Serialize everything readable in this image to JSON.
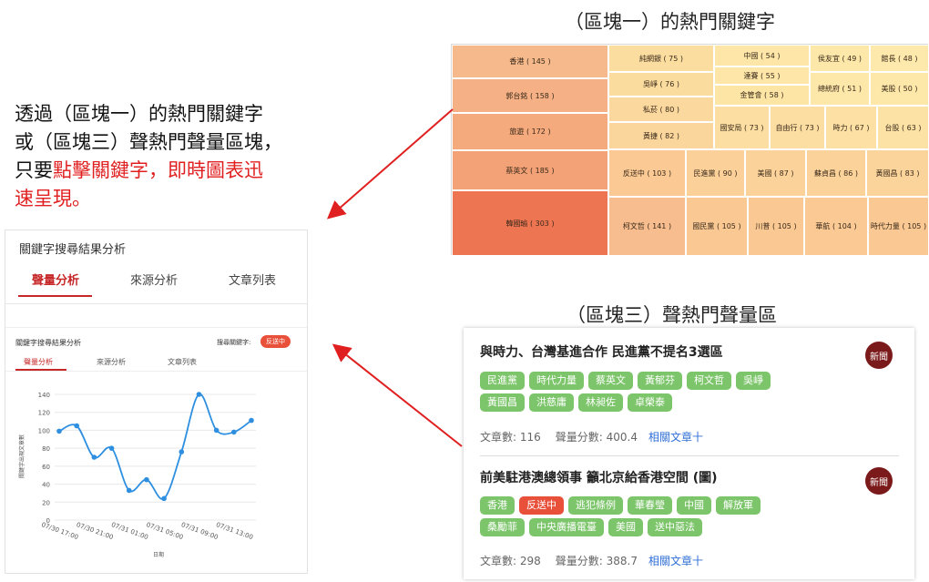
{
  "intro": {
    "line1": "透過（區塊一）的熱門關鍵字",
    "line2": "或（區塊三）聲熱門聲量區塊，",
    "line3_black": "只要",
    "line3_red": "點擊關鍵字，即時圖表迅",
    "line4_red": "速呈現。"
  },
  "block1_title": "（區塊一）的熱門關鍵字",
  "block3_title": "（區塊三）聲熱門聲量區",
  "treemap": {
    "cells": [
      {
        "label": "香港 ( 145 )",
        "color": "#f6b98c"
      },
      {
        "label": "郭台銘 ( 158 )",
        "color": "#f5b185"
      },
      {
        "label": "旅遊 ( 172 )",
        "color": "#f4aa7c"
      },
      {
        "label": "蔡英文 ( 185 )",
        "color": "#f3a176"
      },
      {
        "label": "韓國瑜 ( 303 )",
        "color": "#ee7552"
      },
      {
        "label": "純網銀 ( 75 )",
        "color": "#fbdda0"
      },
      {
        "label": "吳崢 ( 76 )",
        "color": "#fbdc9f"
      },
      {
        "label": "私菸 ( 80 )",
        "color": "#fbd89d"
      },
      {
        "label": "黃捷 ( 82 )",
        "color": "#fbd69c"
      },
      {
        "label": "中國 ( 54 )",
        "color": "#fde6a8"
      },
      {
        "label": "達賽 ( 55 )",
        "color": "#fde6a8"
      },
      {
        "label": "金管會 ( 58 )",
        "color": "#fde5a6"
      },
      {
        "label": "侯友宜 ( 49 )",
        "color": "#fde8aa"
      },
      {
        "label": "總統府 ( 51 )",
        "color": "#fde7a9"
      },
      {
        "label": "館長 ( 48 )",
        "color": "#fde9ab"
      },
      {
        "label": "美股 ( 50 )",
        "color": "#fde8aa"
      },
      {
        "label": "國安局 ( 73 )",
        "color": "#fcdea2"
      },
      {
        "label": "自由行 ( 73 )",
        "color": "#fcdea2"
      },
      {
        "label": "時力 ( 67 )",
        "color": "#fce0a4"
      },
      {
        "label": "台股 ( 63 )",
        "color": "#fce2a5"
      },
      {
        "label": "反送中 ( 103 )",
        "color": "#fac994"
      },
      {
        "label": "民進黨 ( 90 )",
        "color": "#fbd099"
      },
      {
        "label": "美國 ( 87 )",
        "color": "#fbd29a"
      },
      {
        "label": "蘇貞昌 ( 86 )",
        "color": "#fbd29a"
      },
      {
        "label": "黃國昌 ( 83 )",
        "color": "#fbd49b"
      },
      {
        "label": "柯文哲 ( 141 )",
        "color": "#f7bd8e"
      },
      {
        "label": "國民黨 ( 105 )",
        "color": "#fac893"
      },
      {
        "label": "川普 ( 105 )",
        "color": "#fac893"
      },
      {
        "label": "華航 ( 104 )",
        "color": "#fac994"
      },
      {
        "label": "時代力量 ( 105 )",
        "color": "#fac893"
      }
    ]
  },
  "panel": {
    "title": "關鍵字搜尋結果分析",
    "tabs": [
      "聲量分析",
      "來源分析",
      "文章列表"
    ],
    "inner": {
      "title": "關鍵字搜尋結果分析",
      "query_label": "搜尋關鍵字:",
      "query_value": "反送中",
      "tabs": [
        "聲量分析",
        "來源分析",
        "文章列表"
      ]
    }
  },
  "chart_data": {
    "type": "line",
    "x": [
      "07/30 17:00",
      "07/30 19:00",
      "07/30 21:00",
      "07/30 23:00",
      "07/31 01:00",
      "07/31 03:00",
      "07/31 05:00",
      "07/31 07:00",
      "07/31 09:00",
      "07/31 11:00",
      "07/31 13:00",
      "07/31 15:00"
    ],
    "tick_labels": [
      "07/30 17:00",
      "07/30 21:00",
      "07/31 01:00",
      "07/31 05:00",
      "07/31 09:00",
      "07/31 13:00"
    ],
    "values": [
      99,
      105,
      70,
      80,
      33,
      45,
      24,
      76,
      140,
      100,
      98,
      111
    ],
    "ylim": [
      0,
      140
    ],
    "yticks": [
      0,
      20,
      40,
      60,
      80,
      100,
      120,
      140
    ],
    "ylabel": "關鍵字出現文章數",
    "xlabel": "日期",
    "line_color": "#2e8fe0",
    "grid": true
  },
  "news": {
    "items": [
      {
        "title": "與時力、台灣基進合作 民進黨不提名3選區",
        "badge": "新聞",
        "tags": [
          {
            "text": "民進黨",
            "hl": false
          },
          {
            "text": "時代力量",
            "hl": false
          },
          {
            "text": "蔡英文",
            "hl": false
          },
          {
            "text": "黃郁芬",
            "hl": false
          },
          {
            "text": "柯文哲",
            "hl": false
          },
          {
            "text": "吳崢",
            "hl": false
          },
          {
            "text": "黃國昌",
            "hl": false
          },
          {
            "text": "洪慈庸",
            "hl": false
          },
          {
            "text": "林昶佐",
            "hl": false
          },
          {
            "text": "卓榮泰",
            "hl": false
          }
        ],
        "articles": "文章數: 116",
        "score": "聲量分數: 400.4",
        "link": "相關文章十"
      },
      {
        "title": "前美駐港澳總領事 籲北京給香港空間 (圖)",
        "badge": "新聞",
        "tags": [
          {
            "text": "香港",
            "hl": false
          },
          {
            "text": "反送中",
            "hl": true
          },
          {
            "text": "逃犯條例",
            "hl": false
          },
          {
            "text": "華春瑩",
            "hl": false
          },
          {
            "text": "中國",
            "hl": false
          },
          {
            "text": "解放軍",
            "hl": false
          },
          {
            "text": "桑勵菲",
            "hl": false
          },
          {
            "text": "中央廣播電臺",
            "hl": false
          },
          {
            "text": "美國",
            "hl": false
          },
          {
            "text": "送中惡法",
            "hl": false
          }
        ],
        "articles": "文章數: 298",
        "score": "聲量分數: 388.7",
        "link": "相關文章十"
      }
    ]
  },
  "colors": {
    "accent_red": "#e02020",
    "tab_active": "#c62828",
    "tag_green": "#7cc56a",
    "tag_highlight": "#e8503a",
    "badge": "#7b1a1a",
    "link": "#2f6fd6"
  }
}
